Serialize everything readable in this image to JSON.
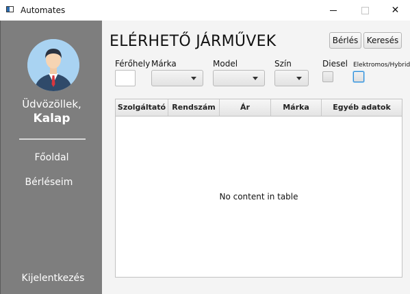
{
  "window": {
    "title": "Automates",
    "close_glyph": "✕"
  },
  "sidebar": {
    "greeting": "Üdvözöllek,",
    "username": "Kalap",
    "nav": {
      "home": "Főoldal",
      "rentals": "Bérléseim",
      "logout": "Kijelentkezés"
    },
    "colors": {
      "background": "#7e7e7e",
      "avatar_bg": "#a9d3f2"
    }
  },
  "main": {
    "title": "ELÉRHETŐ JÁRMŰVEK",
    "buttons": {
      "rent": "Bérlés",
      "search": "Keresés"
    },
    "filters": {
      "seats_label": "Férőhely",
      "brand_label": "Márka",
      "model_label": "Model",
      "color_label": "Szín",
      "diesel_label": "Diesel",
      "electric_label": "Elektromos/Hybrid"
    },
    "table": {
      "columns": [
        "Szolgáltató",
        "Rendszám",
        "Ár",
        "Márka",
        "Egyéb adatok"
      ],
      "empty_message": "No content in table"
    }
  }
}
